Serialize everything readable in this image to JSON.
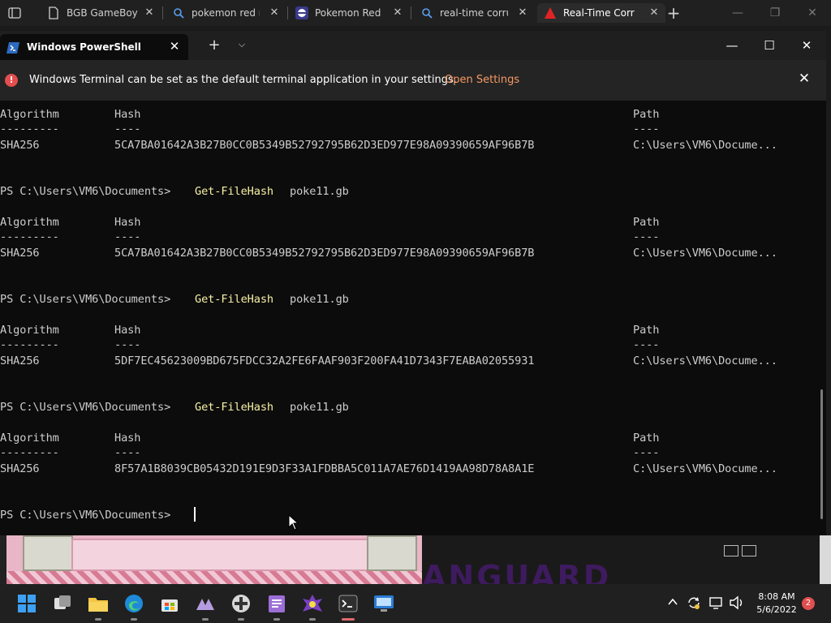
{
  "browser": {
    "tabs": [
      {
        "title": "BGB GameBoy Emulator",
        "icon": "document-icon"
      },
      {
        "title": "pokemon red rom",
        "icon": "search-icon"
      },
      {
        "title": "Pokemon Red Disassembly",
        "icon": "pokeball-icon"
      },
      {
        "title": "real-time corruptor",
        "icon": "search-icon"
      },
      {
        "title": "Real-Time Corruptor",
        "icon": "rtc-icon",
        "active": true
      }
    ],
    "close_glyph": "✕",
    "new_tab_glyph": "+",
    "window_controls": [
      "—",
      "❐",
      "✕"
    ]
  },
  "terminal": {
    "tab_title": "Windows PowerShell",
    "tab_close": "✕",
    "new_tab": "+",
    "dropdown": "⌵",
    "window_controls": [
      "—",
      "☐",
      "✕"
    ],
    "infobar": {
      "message": "Windows Terminal can be set as the default terminal application in your settings.",
      "link": "Open Settings",
      "close": "✕",
      "icon": "!"
    },
    "prompt": "PS C:\\Users\\VM6\\Documents> ",
    "command": "Get-FileHash",
    "argument": "poke11.gb",
    "columns": {
      "algorithm": "Algorithm",
      "hash": "Hash",
      "path": "Path"
    },
    "underlines": {
      "algorithm": "---------",
      "hash": "----",
      "path": "----"
    },
    "results": [
      {
        "algorithm": "SHA256",
        "hash": "5CA7BA01642A3B27B0CC0B5349B52792795B62D3ED977E98A09390659AF96B7B",
        "path": "C:\\Users\\VM6\\Docume..."
      },
      {
        "algorithm": "SHA256",
        "hash": "5CA7BA01642A3B27B0CC0B5349B52792795B62D3ED977E98A09390659AF96B7B",
        "path": "C:\\Users\\VM6\\Docume..."
      },
      {
        "algorithm": "SHA256",
        "hash": "5DF7EC45623009BD675FDCC32A2FE6FAAF903F200FA41D7343F7EABA02055931",
        "path": "C:\\Users\\VM6\\Docume..."
      },
      {
        "algorithm": "SHA256",
        "hash": "8F57A1B8039CB05432D191E9D3F33A1FDBBA5C011A7AE76D1419AA98D78A8A1E",
        "path": "C:\\Users\\VM6\\Docume..."
      }
    ]
  },
  "background": {
    "banner_text": "ANGUARD"
  },
  "taskbar": {
    "apps": [
      "start-icon",
      "task-view-icon",
      "file-explorer-icon",
      "edge-icon",
      "store-icon",
      "vanguard-icon",
      "gamepad-icon",
      "notepad-icon",
      "rtc-icon",
      "terminal-icon",
      "remote-desktop-icon"
    ],
    "time": "8:08 AM",
    "date": "5/6/2022",
    "notifications": "2",
    "tray_chevron": "^"
  }
}
